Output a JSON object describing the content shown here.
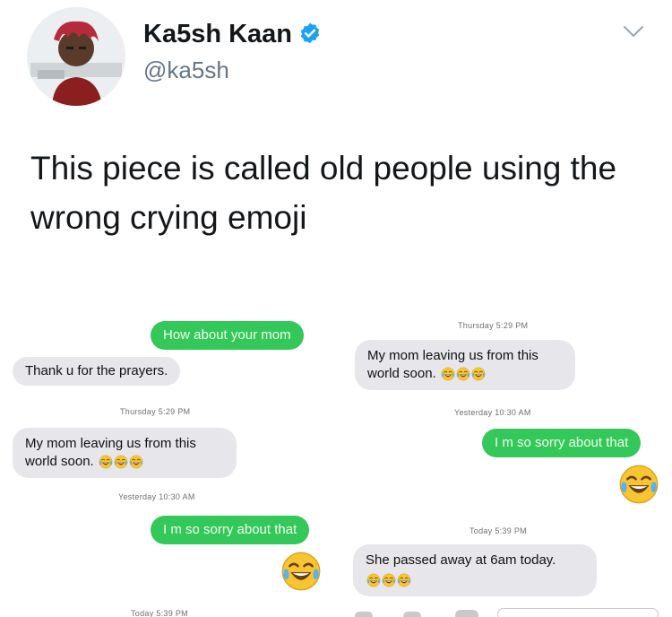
{
  "tweet": {
    "display_name": "Ka5sh Kaan",
    "handle": "@ka5sh",
    "text": "This piece is called old people using the wrong crying emoji"
  },
  "left_screenshot": {
    "msg_outgoing_1": "How about your mom",
    "msg_incoming_1": "Thank u for the prayers.",
    "timestamp_1": "Thursday 5:29 PM",
    "msg_incoming_2": "My mom leaving us from this world soon.",
    "timestamp_2": "Yesterday 10:30 AM",
    "msg_outgoing_2": "I m so sorry about that",
    "timestamp_3": "Today 5:39 PM"
  },
  "right_screenshot": {
    "timestamp_1": "Thursday 5:29 PM",
    "msg_incoming_1": "My mom leaving us from this world soon.",
    "timestamp_2": "Yesterday 10:30 AM",
    "msg_outgoing_1": "I m so sorry about that",
    "timestamp_3": "Today 5:39 PM",
    "msg_incoming_2": "She passed away at 6am today."
  },
  "icons": {
    "verified": "verified-badge-icon",
    "menu": "chevron-down-icon",
    "emoji": "face-with-tears-of-joy-icon"
  },
  "colors": {
    "incoming_bubble": "#e6e6eb",
    "outgoing_bubble": "#34c759",
    "verified_blue": "#1da1f2"
  }
}
